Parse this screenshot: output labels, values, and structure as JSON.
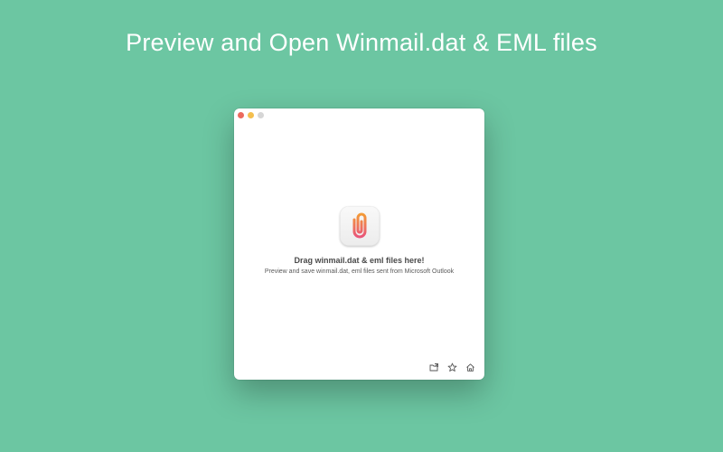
{
  "headline": "Preview and Open Winmail.dat & EML files",
  "window": {
    "drop_title": "Drag winmail.dat & eml files here!",
    "drop_subtitle": "Preview and save winmail.dat, eml files sent from Microsoft Outlook",
    "app_icon": "paperclip-icon",
    "toolbar_icons": [
      "open-folder-icon",
      "star-icon",
      "home-icon"
    ]
  },
  "colors": {
    "background": "#6cc6a2",
    "accent_orange": "#f0863a",
    "accent_pink": "#e9557a"
  }
}
